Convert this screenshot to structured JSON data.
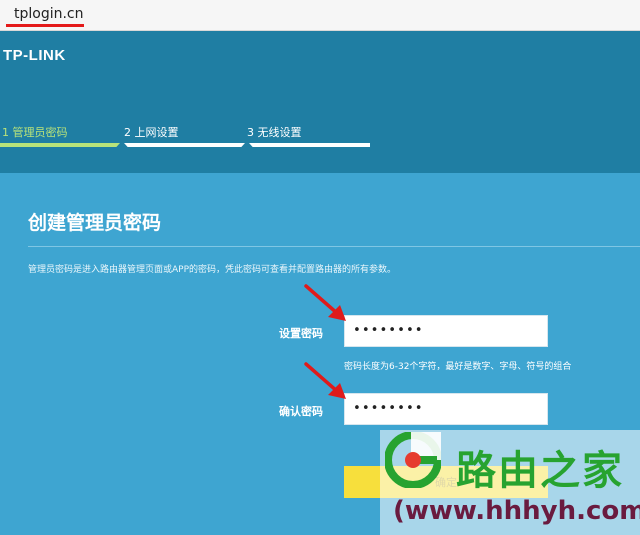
{
  "browser": {
    "address": "tplogin.cn"
  },
  "brand": {
    "logo_text": "TP-LINK"
  },
  "steps": [
    {
      "label": "1 管理员密码",
      "active": true
    },
    {
      "label": "2 上网设置",
      "active": false
    },
    {
      "label": "3 无线设置",
      "active": false
    }
  ],
  "page": {
    "title": "创建管理员密码",
    "description": "管理员密码是进入路由器管理页面或APP的密码，凭此密码可查看并配置路由器的所有参数。"
  },
  "form": {
    "password_label": "设置密码",
    "password_value": "••••••••",
    "password_hint": "密码长度为6-32个字符，最好是数字、字母、符号的组合",
    "confirm_label": "确认密码",
    "confirm_value": "••••••••",
    "submit_label": "确定"
  },
  "watermark": {
    "name": "路由之家",
    "url": "(www.hhhyh.com)"
  },
  "colors": {
    "header": "#1f7ea3",
    "content": "#3ea5d1",
    "active_step": "#b8e37a",
    "button": "#f7df3c",
    "arrow": "#e01b1b",
    "watermark_green": "#27a330",
    "watermark_url": "#6a1b3f"
  },
  "icons": {
    "arrow": "red-arrow-icon",
    "watermark_logo": "luyouzhijia-logo-icon"
  }
}
